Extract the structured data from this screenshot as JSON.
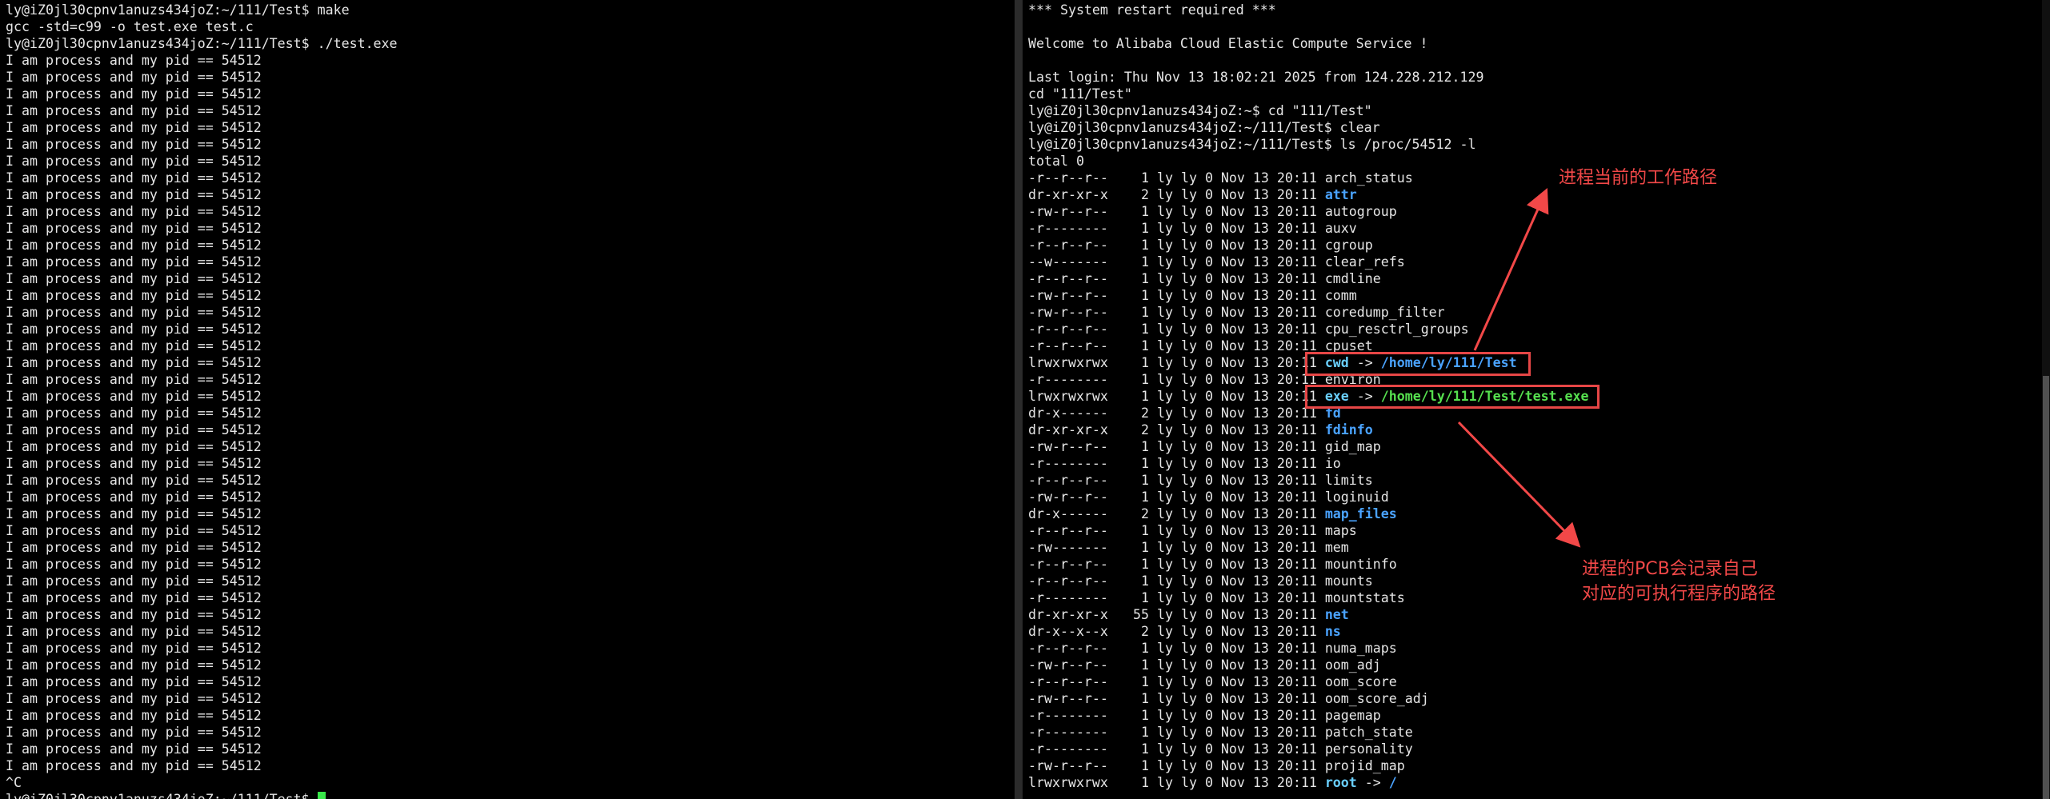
{
  "left_terminal": {
    "lines": [
      "ly@iZ0jl30cpnv1anuzs434joZ:~/111/Test$ make",
      "gcc -std=c99 -o test.exe test.c",
      "ly@iZ0jl30cpnv1anuzs434joZ:~/111/Test$ ./test.exe",
      "I am process and my pid == 54512",
      "I am process and my pid == 54512",
      "I am process and my pid == 54512",
      "I am process and my pid == 54512",
      "I am process and my pid == 54512",
      "I am process and my pid == 54512",
      "I am process and my pid == 54512",
      "I am process and my pid == 54512",
      "I am process and my pid == 54512",
      "I am process and my pid == 54512",
      "I am process and my pid == 54512",
      "I am process and my pid == 54512",
      "I am process and my pid == 54512",
      "I am process and my pid == 54512",
      "I am process and my pid == 54512",
      "I am process and my pid == 54512",
      "I am process and my pid == 54512",
      "I am process and my pid == 54512",
      "I am process and my pid == 54512",
      "I am process and my pid == 54512",
      "I am process and my pid == 54512",
      "I am process and my pid == 54512",
      "I am process and my pid == 54512",
      "I am process and my pid == 54512",
      "I am process and my pid == 54512",
      "I am process and my pid == 54512",
      "I am process and my pid == 54512",
      "I am process and my pid == 54512",
      "I am process and my pid == 54512",
      "I am process and my pid == 54512",
      "I am process and my pid == 54512",
      "I am process and my pid == 54512",
      "I am process and my pid == 54512",
      "I am process and my pid == 54512",
      "I am process and my pid == 54512",
      "I am process and my pid == 54512",
      "I am process and my pid == 54512",
      "I am process and my pid == 54512",
      "I am process and my pid == 54512",
      "I am process and my pid == 54512",
      "I am process and my pid == 54512",
      "I am process and my pid == 54512",
      "I am process and my pid == 54512",
      "^C"
    ],
    "prompt_line": "ly@iZ0jl30cpnv1anuzs434joZ:~/111/Test$ "
  },
  "right_terminal": {
    "header_lines": [
      "*** System restart required ***",
      "",
      "Welcome to Alibaba Cloud Elastic Compute Service !",
      "",
      "Last login: Thu Nov 13 18:02:21 2025 from 124.228.212.129",
      "cd \"111/Test\"",
      "ly@iZ0jl30cpnv1anuzs434joZ:~$ cd \"111/Test\"",
      "ly@iZ0jl30cpnv1anuzs434joZ:~/111/Test$ clear",
      "ly@iZ0jl30cpnv1anuzs434joZ:~/111/Test$ ls /proc/54512 -l",
      "total 0"
    ],
    "entries": [
      {
        "perm": "-r--r--r--",
        "links": "1",
        "meta": "ly ly 0 Nov 13 20:11",
        "name": "arch_status",
        "type": "file"
      },
      {
        "perm": "dr-xr-xr-x",
        "links": "2",
        "meta": "ly ly 0 Nov 13 20:11",
        "name": "attr",
        "type": "dir"
      },
      {
        "perm": "-rw-r--r--",
        "links": "1",
        "meta": "ly ly 0 Nov 13 20:11",
        "name": "autogroup",
        "type": "file"
      },
      {
        "perm": "-r--------",
        "links": "1",
        "meta": "ly ly 0 Nov 13 20:11",
        "name": "auxv",
        "type": "file"
      },
      {
        "perm": "-r--r--r--",
        "links": "1",
        "meta": "ly ly 0 Nov 13 20:11",
        "name": "cgroup",
        "type": "file"
      },
      {
        "perm": "--w-------",
        "links": "1",
        "meta": "ly ly 0 Nov 13 20:11",
        "name": "clear_refs",
        "type": "file"
      },
      {
        "perm": "-r--r--r--",
        "links": "1",
        "meta": "ly ly 0 Nov 13 20:11",
        "name": "cmdline",
        "type": "file"
      },
      {
        "perm": "-rw-r--r--",
        "links": "1",
        "meta": "ly ly 0 Nov 13 20:11",
        "name": "comm",
        "type": "file"
      },
      {
        "perm": "-rw-r--r--",
        "links": "1",
        "meta": "ly ly 0 Nov 13 20:11",
        "name": "coredump_filter",
        "type": "file"
      },
      {
        "perm": "-r--r--r--",
        "links": "1",
        "meta": "ly ly 0 Nov 13 20:11",
        "name": "cpu_resctrl_groups",
        "type": "file"
      },
      {
        "perm": "-r--r--r--",
        "links": "1",
        "meta": "ly ly 0 Nov 13 20:11",
        "name": "cpuset",
        "type": "file"
      },
      {
        "perm": "lrwxrwxrwx",
        "links": "1",
        "meta": "ly ly 0 Nov 13 20:11",
        "name": "cwd",
        "type": "link",
        "target": "/home/ly/111/Test"
      },
      {
        "perm": "-r--------",
        "links": "1",
        "meta": "ly ly 0 Nov 13 20:11",
        "name": "environ",
        "type": "file"
      },
      {
        "perm": "lrwxrwxrwx",
        "links": "1",
        "meta": "ly ly 0 Nov 13 20:11",
        "name": "exe",
        "type": "link",
        "target": "/home/ly/111/Test/test.exe",
        "target_style": "exe"
      },
      {
        "perm": "dr-x------",
        "links": "2",
        "meta": "ly ly 0 Nov 13 20:11",
        "name": "fd",
        "type": "dir"
      },
      {
        "perm": "dr-xr-xr-x",
        "links": "2",
        "meta": "ly ly 0 Nov 13 20:11",
        "name": "fdinfo",
        "type": "dir"
      },
      {
        "perm": "-rw-r--r--",
        "links": "1",
        "meta": "ly ly 0 Nov 13 20:11",
        "name": "gid_map",
        "type": "file"
      },
      {
        "perm": "-r--------",
        "links": "1",
        "meta": "ly ly 0 Nov 13 20:11",
        "name": "io",
        "type": "file"
      },
      {
        "perm": "-r--r--r--",
        "links": "1",
        "meta": "ly ly 0 Nov 13 20:11",
        "name": "limits",
        "type": "file"
      },
      {
        "perm": "-rw-r--r--",
        "links": "1",
        "meta": "ly ly 0 Nov 13 20:11",
        "name": "loginuid",
        "type": "file"
      },
      {
        "perm": "dr-x------",
        "links": "2",
        "meta": "ly ly 0 Nov 13 20:11",
        "name": "map_files",
        "type": "dir"
      },
      {
        "perm": "-r--r--r--",
        "links": "1",
        "meta": "ly ly 0 Nov 13 20:11",
        "name": "maps",
        "type": "file"
      },
      {
        "perm": "-rw-------",
        "links": "1",
        "meta": "ly ly 0 Nov 13 20:11",
        "name": "mem",
        "type": "file"
      },
      {
        "perm": "-r--r--r--",
        "links": "1",
        "meta": "ly ly 0 Nov 13 20:11",
        "name": "mountinfo",
        "type": "file"
      },
      {
        "perm": "-r--r--r--",
        "links": "1",
        "meta": "ly ly 0 Nov 13 20:11",
        "name": "mounts",
        "type": "file"
      },
      {
        "perm": "-r--------",
        "links": "1",
        "meta": "ly ly 0 Nov 13 20:11",
        "name": "mountstats",
        "type": "file"
      },
      {
        "perm": "dr-xr-xr-x",
        "links": "55",
        "meta": "ly ly 0 Nov 13 20:11",
        "name": "net",
        "type": "dir"
      },
      {
        "perm": "dr-x--x--x",
        "links": "2",
        "meta": "ly ly 0 Nov 13 20:11",
        "name": "ns",
        "type": "dir"
      },
      {
        "perm": "-r--r--r--",
        "links": "1",
        "meta": "ly ly 0 Nov 13 20:11",
        "name": "numa_maps",
        "type": "file"
      },
      {
        "perm": "-rw-r--r--",
        "links": "1",
        "meta": "ly ly 0 Nov 13 20:11",
        "name": "oom_adj",
        "type": "file"
      },
      {
        "perm": "-r--r--r--",
        "links": "1",
        "meta": "ly ly 0 Nov 13 20:11",
        "name": "oom_score",
        "type": "file"
      },
      {
        "perm": "-rw-r--r--",
        "links": "1",
        "meta": "ly ly 0 Nov 13 20:11",
        "name": "oom_score_adj",
        "type": "file"
      },
      {
        "perm": "-r--------",
        "links": "1",
        "meta": "ly ly 0 Nov 13 20:11",
        "name": "pagemap",
        "type": "file"
      },
      {
        "perm": "-r--------",
        "links": "1",
        "meta": "ly ly 0 Nov 13 20:11",
        "name": "patch_state",
        "type": "file"
      },
      {
        "perm": "-r--------",
        "links": "1",
        "meta": "ly ly 0 Nov 13 20:11",
        "name": "personality",
        "type": "file"
      },
      {
        "perm": "-rw-r--r--",
        "links": "1",
        "meta": "ly ly 0 Nov 13 20:11",
        "name": "projid_map",
        "type": "file"
      },
      {
        "perm": "lrwxrwxrwx",
        "links": "1",
        "meta": "ly ly 0 Nov 13 20:11",
        "name": "root",
        "type": "link",
        "target": "/"
      }
    ]
  },
  "annotations": {
    "cwd_note": "进程当前的工作路径",
    "exe_note_line1": "进程的PCB会记录自己",
    "exe_note_line2": "对应的可执行程序的路径",
    "color": "#f24848"
  },
  "colors": {
    "background": "#000000",
    "text": "#e6e6e6",
    "directory": "#4aa3ff",
    "exe_target": "#56e04f",
    "cursor": "#39e84a"
  }
}
